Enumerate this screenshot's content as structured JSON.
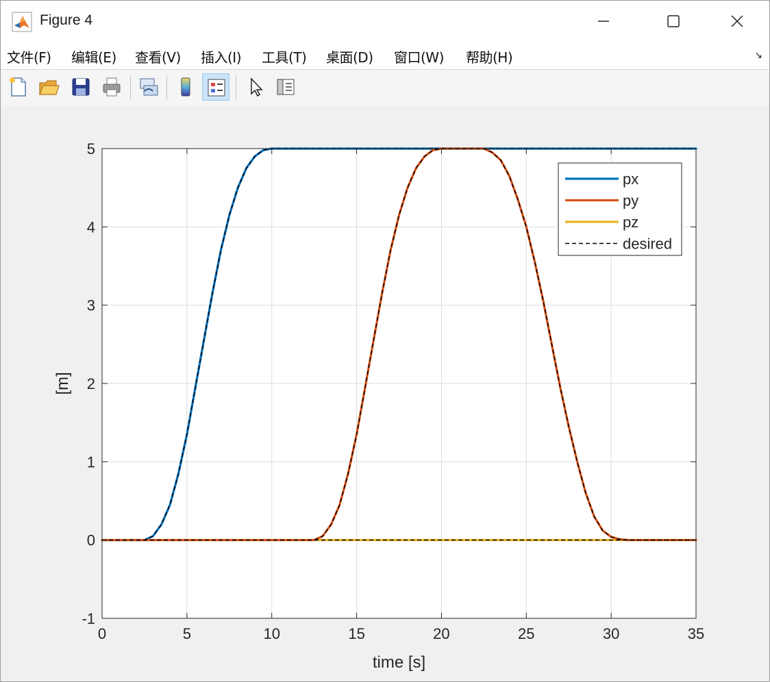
{
  "window": {
    "title": "Figure 4"
  },
  "menu": [
    {
      "label": "文件(F)"
    },
    {
      "label": "编辑(E)"
    },
    {
      "label": "查看(V)"
    },
    {
      "label": "插入(I)"
    },
    {
      "label": "工具(T)"
    },
    {
      "label": "桌面(D)"
    },
    {
      "label": "窗口(W)"
    },
    {
      "label": "帮助(H)"
    }
  ],
  "toolbar": [
    {
      "icon": "new-figure-icon"
    },
    {
      "icon": "open-file-icon"
    },
    {
      "icon": "save-icon"
    },
    {
      "icon": "print-icon"
    },
    {
      "icon": "link-plot-icon"
    },
    {
      "icon": "colorbar-icon"
    },
    {
      "icon": "legend-icon",
      "active": true
    },
    {
      "icon": "pointer-icon"
    },
    {
      "icon": "property-editor-icon"
    }
  ],
  "chart_data": {
    "type": "line",
    "xlabel": "time [s]",
    "ylabel": "[m]",
    "xlim": [
      0,
      35
    ],
    "ylim": [
      -1,
      5
    ],
    "xticks": [
      0,
      5,
      10,
      15,
      20,
      25,
      30,
      35
    ],
    "yticks": [
      -1,
      0,
      1,
      2,
      3,
      4,
      5
    ],
    "grid": true,
    "legend_position": "top-right",
    "series": [
      {
        "name": "px",
        "color": "#0072bd",
        "x": [
          0,
          2.5,
          3,
          3.5,
          4,
          4.5,
          5,
          5.5,
          6,
          6.5,
          7,
          7.5,
          8,
          8.5,
          9,
          9.5,
          10,
          35
        ],
        "y": [
          0,
          0,
          0.05,
          0.2,
          0.45,
          0.85,
          1.35,
          1.95,
          2.55,
          3.15,
          3.7,
          4.15,
          4.5,
          4.75,
          4.9,
          4.98,
          5,
          5
        ]
      },
      {
        "name": "py",
        "color": "#d95319",
        "x": [
          0,
          12.5,
          13,
          13.5,
          14,
          14.5,
          15,
          15.5,
          16,
          16.5,
          17,
          17.5,
          18,
          18.5,
          19,
          19.5,
          20,
          22.5,
          23,
          23.5,
          24,
          24.5,
          25,
          25.5,
          26,
          26.5,
          27,
          27.5,
          28,
          28.5,
          29,
          29.5,
          30,
          30.5,
          31,
          31.5,
          32,
          35
        ],
        "y": [
          0,
          0,
          0.05,
          0.2,
          0.45,
          0.85,
          1.35,
          1.95,
          2.55,
          3.15,
          3.7,
          4.15,
          4.5,
          4.75,
          4.9,
          4.98,
          5,
          5,
          4.95,
          4.85,
          4.65,
          4.35,
          4.0,
          3.55,
          3.05,
          2.5,
          1.95,
          1.45,
          1.0,
          0.6,
          0.3,
          0.12,
          0.04,
          0.01,
          0,
          0,
          0,
          0
        ]
      },
      {
        "name": "pz",
        "color": "#edb120",
        "x": [
          0,
          35
        ],
        "y": [
          0,
          0
        ]
      },
      {
        "name": "desired",
        "color": "#000000",
        "dashed": true,
        "segments": [
          {
            "x": [
              0,
              2.5,
              3,
              3.5,
              4,
              4.5,
              5,
              5.5,
              6,
              6.5,
              7,
              7.5,
              8,
              8.5,
              9,
              9.5,
              10,
              35
            ],
            "y": [
              0,
              0,
              0.05,
              0.2,
              0.45,
              0.85,
              1.35,
              1.95,
              2.55,
              3.15,
              3.7,
              4.15,
              4.5,
              4.75,
              4.9,
              4.98,
              5,
              5
            ]
          },
          {
            "x": [
              0,
              12.5,
              13,
              13.5,
              14,
              14.5,
              15,
              15.5,
              16,
              16.5,
              17,
              17.5,
              18,
              18.5,
              19,
              19.5,
              20,
              22.5,
              23,
              23.5,
              24,
              24.5,
              25,
              25.5,
              26,
              26.5,
              27,
              27.5,
              28,
              28.5,
              29,
              29.5,
              30,
              30.5,
              31,
              31.5,
              32,
              35
            ],
            "y": [
              0,
              0,
              0.05,
              0.2,
              0.45,
              0.85,
              1.35,
              1.95,
              2.55,
              3.15,
              3.7,
              4.15,
              4.5,
              4.75,
              4.9,
              4.98,
              5,
              5,
              4.95,
              4.85,
              4.65,
              4.35,
              4.0,
              3.55,
              3.05,
              2.5,
              1.95,
              1.45,
              1.0,
              0.6,
              0.3,
              0.12,
              0.04,
              0.01,
              0,
              0,
              0,
              0
            ]
          },
          {
            "x": [
              0,
              35
            ],
            "y": [
              0,
              0
            ]
          }
        ]
      }
    ]
  }
}
